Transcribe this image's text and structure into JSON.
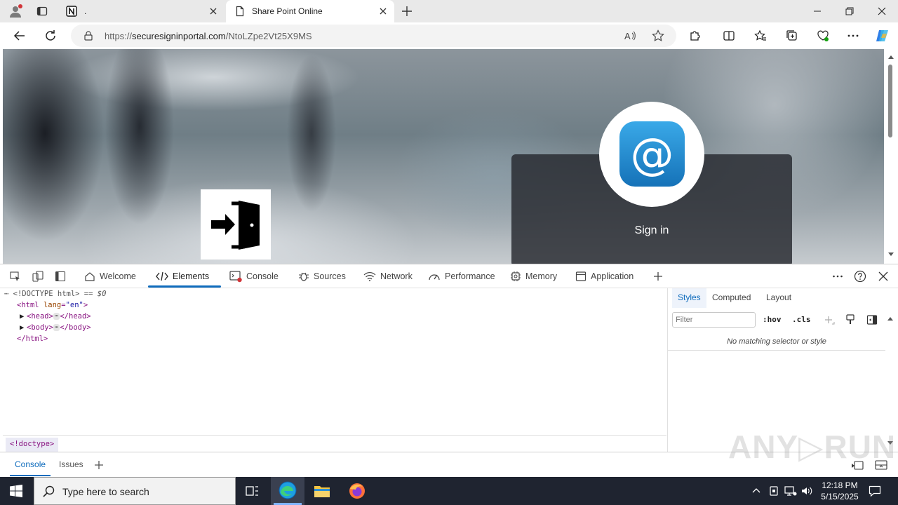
{
  "browser": {
    "tabs": [
      {
        "label": ".",
        "icon": "notion-icon",
        "active": false
      },
      {
        "label": "Share Point Online",
        "icon": "page-icon",
        "active": true
      }
    ],
    "address": {
      "scheme": "https://",
      "domain": "securesigninportal.com",
      "path": "/NtoLZpe2Vt25X9MS"
    }
  },
  "page": {
    "signin_title": "Sign in",
    "at_symbol": "@",
    "logo": "door-enter-icon"
  },
  "devtools": {
    "tabs": [
      "Welcome",
      "Elements",
      "Console",
      "Sources",
      "Network",
      "Performance",
      "Memory",
      "Application"
    ],
    "active_tab": "Elements",
    "dom": {
      "doctype": "<!DOCTYPE html>",
      "selected_marker": " == $0",
      "html_open": "<html",
      "lang_attr": "lang",
      "lang_val": "\"en\"",
      "head_open": "<head>",
      "head_close": "</head>",
      "body_open": "<body>",
      "body_close": "</body>",
      "html_close": "</html>",
      "ellipsis": "⋯"
    },
    "breadcrumb": "<!doctype>",
    "styles": {
      "tabs": [
        "Styles",
        "Computed",
        "Layout"
      ],
      "filter_placeholder": "Filter",
      "hov": ":hov",
      "cls": ".cls",
      "empty_message": "No matching selector or style"
    },
    "drawer_tabs": [
      "Console",
      "Issues"
    ]
  },
  "taskbar": {
    "search_placeholder": "Type here to search",
    "time": "12:18 PM",
    "date": "5/15/2025"
  },
  "watermark": "ANY▷RUN",
  "colors": {
    "accent": "#0f6cbd",
    "taskbar": "#1f2430",
    "signin_panel": "#26282e",
    "at_tile": "#1e8ad4"
  }
}
